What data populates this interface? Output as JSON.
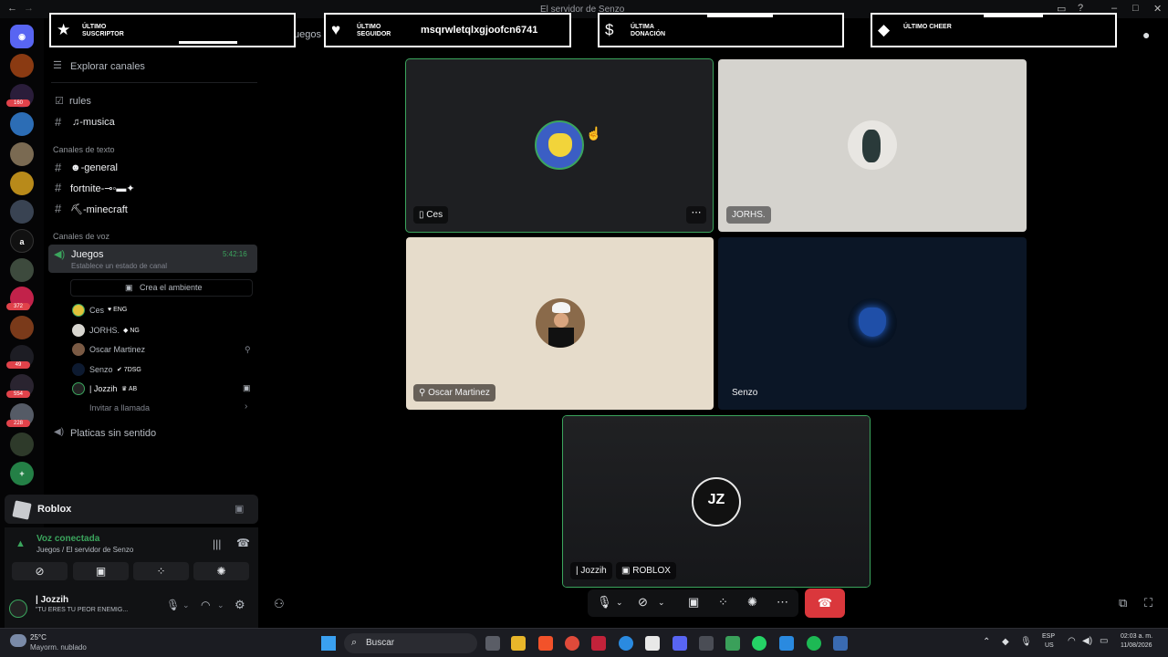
{
  "window": {
    "title": "El servidor de Senzo"
  },
  "overlays": [
    {
      "icon": "★",
      "label": "ÚLTIMO SUSCRIPTOR",
      "value": ""
    },
    {
      "icon": "♥",
      "label": "ÚLTIMO SEGUIDOR",
      "value": "msqrwletqlxgjoofcn6741"
    },
    {
      "icon": "$",
      "label": "ÚLTIMA DONACIÓN",
      "value": ""
    },
    {
      "icon": "◆",
      "label": "ÚLTIMO CHEER",
      "value": ""
    }
  ],
  "behind_text": "uegos",
  "rail": {
    "badges": [
      "160",
      "372",
      "49",
      "554",
      "228"
    ],
    "letter": "a"
  },
  "channels": {
    "explore": "Explorar canales",
    "rules": "rules",
    "musica": "♫-musica",
    "text_category": "Canales de texto",
    "general": "☻-general",
    "fortnite": "fortnite-⊸◦▬✦",
    "minecraft": "⛏-minecraft",
    "voice_category": "Canales de voz",
    "juegos": "Juegos",
    "juegos_time": "5:42:16",
    "juegos_status": "Establece un estado de canal",
    "ambiente": "Crea el ambiente",
    "members": [
      {
        "name": "Ces",
        "tag": "♥ ENG"
      },
      {
        "name": "JORHS.",
        "tag": "◆ NG"
      },
      {
        "name": "Oscar Martinez",
        "tag": ""
      },
      {
        "name": "Senzo",
        "tag": "✔ 7DSG"
      },
      {
        "name": "| Jozzih",
        "tag": "♛ AB"
      }
    ],
    "invite": "Invitar a llamada",
    "platicas": "Platicas sin sentido"
  },
  "activity": {
    "name": "Roblox"
  },
  "voice": {
    "status": "Voz conectada",
    "location": "Juegos / El servidor de Senzo"
  },
  "user": {
    "name": "| Jozzih",
    "status": "\"TÚ ERES TU PEOR ENEMIG..."
  },
  "tiles": [
    {
      "name": "Ces",
      "accent": "#1e1f22"
    },
    {
      "name": "JORHS.",
      "accent": "#d5d3ce"
    },
    {
      "name": "Oscar Martinez",
      "accent": "#e6dccb"
    },
    {
      "name": "Senzo",
      "accent": "#0b1626"
    },
    {
      "name": "| Jozzih",
      "extra": "ROBLOX",
      "accent": "#1a1b1d"
    }
  ],
  "taskbar": {
    "temp": "25°C",
    "weather": "Mayorm. nublado",
    "search": "Buscar",
    "lang1": "ESP",
    "lang2": "US",
    "time": "02:03 a. m.",
    "date": "11/08/2026"
  },
  "colors": {
    "accent_green": "#3ba55d",
    "hangup_red": "#da373c"
  }
}
